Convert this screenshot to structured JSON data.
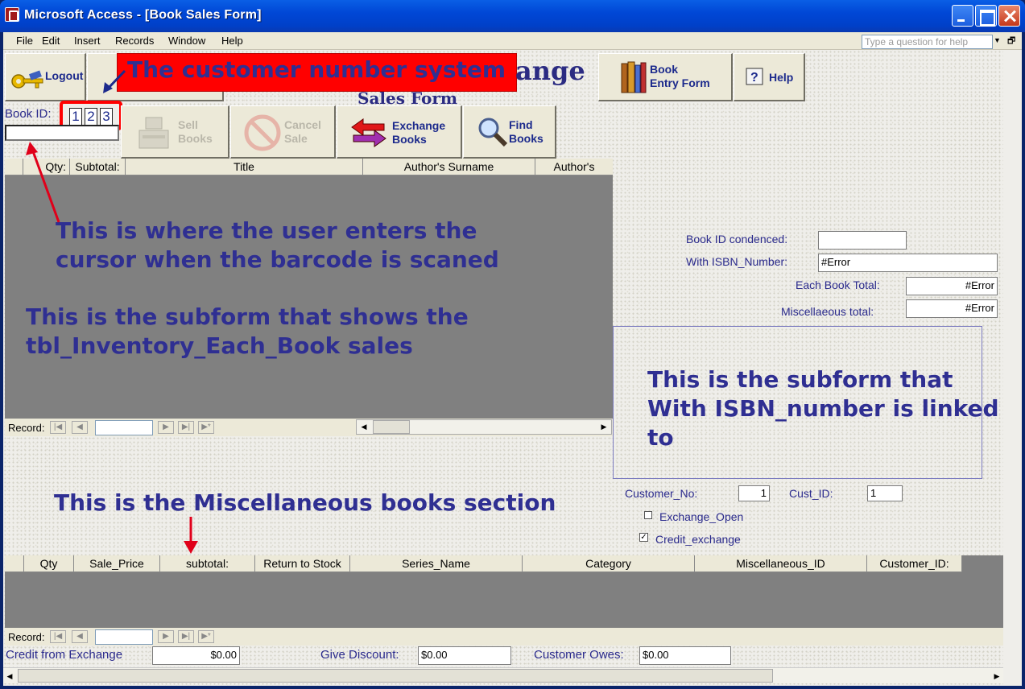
{
  "window": {
    "title": "Microsoft Access - [Book Sales Form]"
  },
  "menu": {
    "items": [
      "File",
      "Edit",
      "Insert",
      "Records",
      "Window",
      "Help"
    ],
    "help_placeholder": "Type a question for help"
  },
  "toolbar": {
    "logout": "Logout",
    "form_title_fragment": "ange",
    "subtitle": "Sales Form",
    "book_entry": [
      "Book",
      "Entry Form"
    ],
    "help": "Help",
    "sell_books": [
      "Sell",
      "Books"
    ],
    "cancel_sale": [
      "Cancel",
      "Sale"
    ],
    "exchange_books": [
      "Exchange",
      "Books"
    ],
    "find_books": [
      "Find",
      "Books"
    ]
  },
  "book_id": {
    "label": "Book ID:",
    "badge": [
      "1",
      "2",
      "3"
    ],
    "value": ""
  },
  "sales_grid": {
    "headers": [
      "",
      "Qty:",
      "Subtotal:",
      "Title",
      "Author's Surname",
      "Author's"
    ],
    "record_label": "Record:"
  },
  "details": {
    "book_id_condensed_label": "Book ID condenced:",
    "book_id_condensed_value": "",
    "isbn_label": "With ISBN_Number:",
    "isbn_value": "#Error",
    "each_book_total_label": "Each Book Total:",
    "each_book_total_value": "#Error",
    "misc_total_label": "Miscellaeous total:",
    "misc_total_value": "#Error"
  },
  "customer": {
    "customer_no_label": "Customer_No:",
    "customer_no_value": "1",
    "cust_id_label": "Cust_ID:",
    "cust_id_value": "1",
    "exchange_open_label": "Exchange_Open",
    "exchange_open_checked": false,
    "credit_exchange_label": "Credit_exchange",
    "credit_exchange_checked": true
  },
  "misc_grid": {
    "headers": [
      "",
      "Qty",
      "Sale_Price",
      "subtotal:",
      "Return to Stock",
      "Series_Name",
      "Category",
      "Miscellaneous_ID",
      "Customer_ID:"
    ],
    "record_label": "Record:"
  },
  "totals": {
    "credit_label": "Credit from Exchange",
    "credit_value": "$0.00",
    "discount_label": "Give Discount:",
    "discount_value": "$0.00",
    "owes_label": "Customer Owes:",
    "owes_value": "$0.00"
  },
  "annotations": {
    "customer_number": "The customer number system",
    "cursor_line1": "This is where the user enters the",
    "cursor_line2": "cursor when the barcode is scaned",
    "subform_line1": "This is the subform that shows the",
    "subform_line2": "tbl_Inventory_Each_Book sales",
    "isbn_line1": "This is the subform that",
    "isbn_line2": "With ISBN_number is linked",
    "isbn_line3": "to",
    "misc_section": "This is the Miscellaneous books section"
  },
  "colors": {
    "annotation": "#2f2f92",
    "arrow": "#e0001a",
    "callout_bg": "#ff0000",
    "highlight_box": "#ff0000"
  }
}
